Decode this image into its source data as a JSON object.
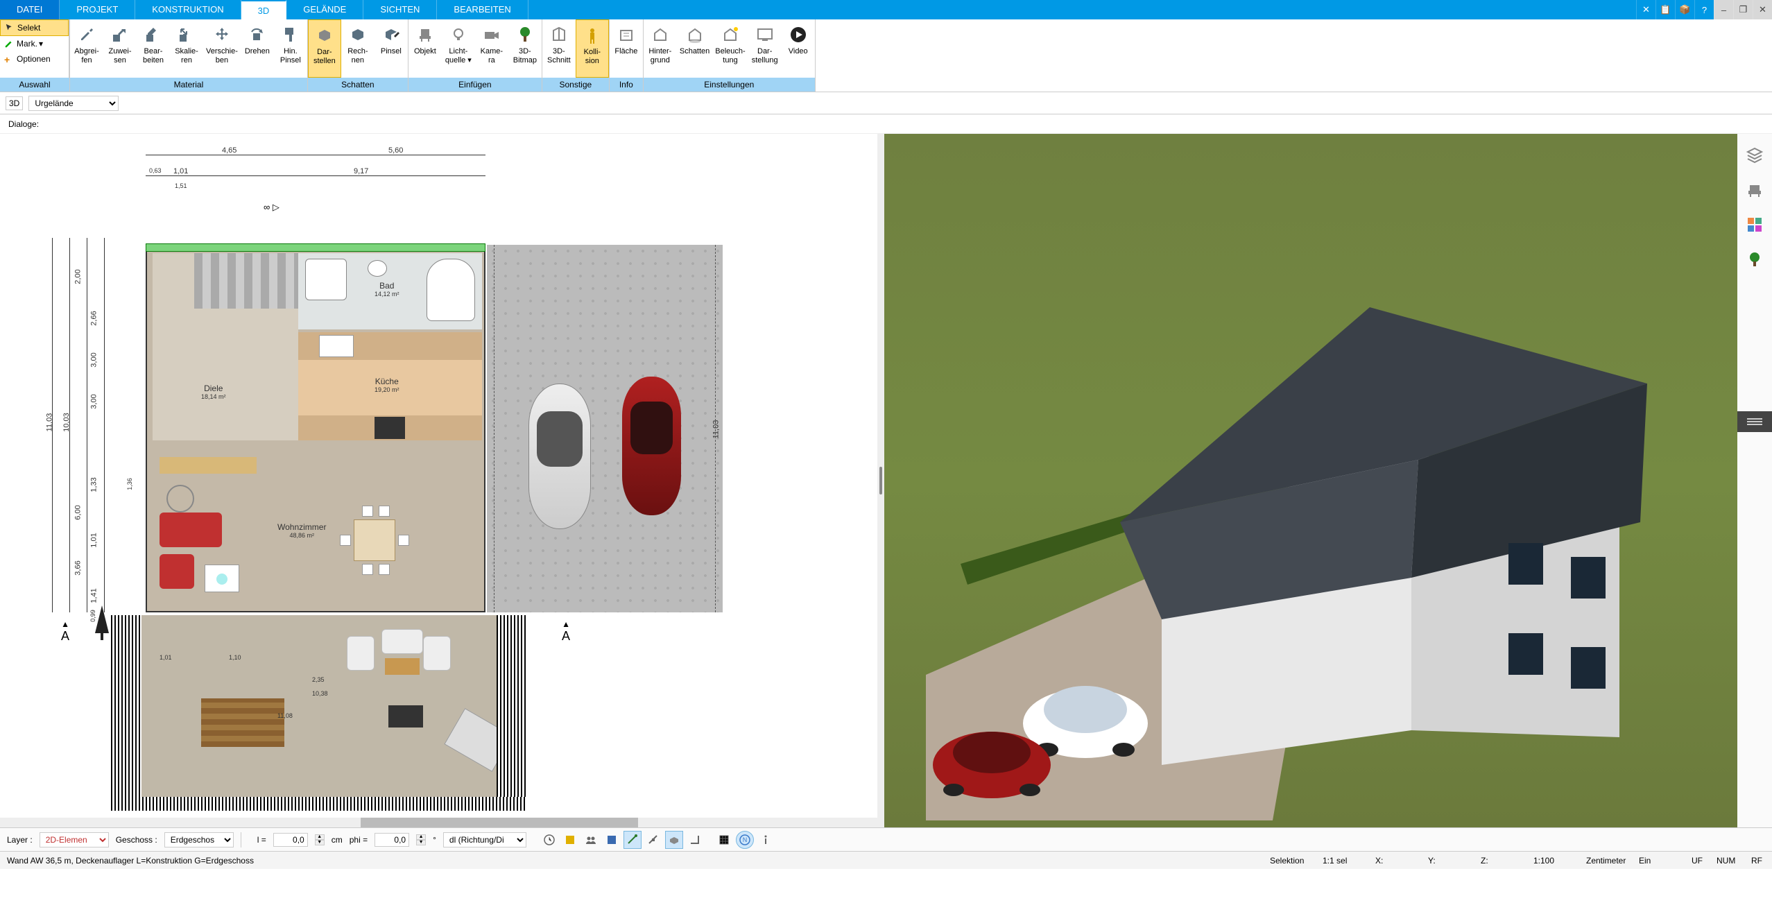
{
  "menu": {
    "tabs": [
      "DATEI",
      "PROJEKT",
      "KONSTRUKTION",
      "3D",
      "GELÄNDE",
      "SICHTEN",
      "BEARBEITEN"
    ],
    "active_index": 3
  },
  "side_tools": {
    "selekt": "Selekt",
    "mark": "Mark.",
    "optionen": "Optionen"
  },
  "ribbon": {
    "groups": [
      {
        "label": "Auswahl",
        "items": []
      },
      {
        "label": "Material",
        "items": [
          {
            "key": "abgreifen",
            "label": "Abgrei-\nfen"
          },
          {
            "key": "zuweisen",
            "label": "Zuwei-\nsen"
          },
          {
            "key": "bearbeiten",
            "label": "Bear-\nbeiten"
          },
          {
            "key": "skalieren",
            "label": "Skalie-\nren"
          },
          {
            "key": "verschieben",
            "label": "Verschie-\nben"
          },
          {
            "key": "drehen",
            "label": "Drehen"
          },
          {
            "key": "hinpinsel",
            "label": "Hin.\nPinsel"
          }
        ]
      },
      {
        "label": "Schatten",
        "items": [
          {
            "key": "darstellen",
            "label": "Dar-\nstellen",
            "active": true
          },
          {
            "key": "rechnen",
            "label": "Rech-\nnen"
          },
          {
            "key": "pinsel",
            "label": "Pinsel"
          }
        ]
      },
      {
        "label": "Einfügen",
        "items": [
          {
            "key": "objekt",
            "label": "Objekt"
          },
          {
            "key": "lichtquelle",
            "label": "Licht-\nquelle ▾"
          },
          {
            "key": "kamera",
            "label": "Kame-\nra"
          },
          {
            "key": "bitmap",
            "label": "3D-\nBitmap"
          }
        ]
      },
      {
        "label": "Sonstige",
        "items": [
          {
            "key": "schnitt",
            "label": "3D-\nSchnitt"
          },
          {
            "key": "kollision",
            "label": "Kolli-\nsion",
            "active": true
          }
        ]
      },
      {
        "label": "Info",
        "items": [
          {
            "key": "flaeche",
            "label": "Fläche"
          }
        ]
      },
      {
        "label": "Einstellungen",
        "items": [
          {
            "key": "hintergrund",
            "label": "Hinter-\ngrund"
          },
          {
            "key": "schatten2",
            "label": "Schatten"
          },
          {
            "key": "beleuchtung",
            "label": "Beleuch-\ntung"
          },
          {
            "key": "darstellung",
            "label": "Dar-\nstellung"
          },
          {
            "key": "video",
            "label": "Video"
          }
        ]
      }
    ]
  },
  "sub_bar": {
    "view_mode": "3D",
    "layer_selection": "Urgelände"
  },
  "dialog_bar": {
    "label": "Dialoge:"
  },
  "floorplan": {
    "dims_top": {
      "d1": "4,65",
      "d2": "5,60"
    },
    "dims_mid": {
      "d1": "1,01",
      "d2": "9,17",
      "d3": "1,51",
      "d4": "0,63"
    },
    "rooms": {
      "diele": {
        "name": "Diele",
        "area": "18,14 m²"
      },
      "bad": {
        "name": "Bad",
        "area": "14,12 m²"
      },
      "kueche": {
        "name": "Küche",
        "area": "19,20 m²"
      },
      "wohn": {
        "name": "Wohnzimmer",
        "area": "48,86 m²"
      }
    },
    "section_marks": "A",
    "vert_dims": [
      "2,00",
      "2,66",
      "3,00",
      "3,00",
      "11,03",
      "10,03",
      "1,36",
      "1,33",
      "6,00",
      "1,01",
      "3,66",
      "1,41",
      "0,99"
    ],
    "garden_dims": [
      "1,01",
      "1,10",
      "2,35",
      "10,38",
      "11,08"
    ],
    "parking_dim": "11,03"
  },
  "bottom_bar": {
    "layer_label": "Layer :",
    "layer_value": "2D-Elemen",
    "geschoss_label": "Geschoss :",
    "geschoss_value": "Erdgeschos",
    "l_label": "l =",
    "l_value": "0,0",
    "l_unit": "cm",
    "phi_label": "phi =",
    "phi_value": "0,0",
    "phi_unit": "°",
    "snap_value": "dl (Richtung/Di"
  },
  "status_bar": {
    "message": "Wand AW 36,5 m, Deckenauflager L=Konstruktion G=Erdgeschoss",
    "selection": "Selektion",
    "sel_count": "1:1 sel",
    "x_label": "X:",
    "y_label": "Y:",
    "z_label": "Z:",
    "scale": "1:100",
    "unit": "Zentimeter",
    "mode": "Ein",
    "uf": "UF",
    "num": "NUM",
    "rf": "RF"
  }
}
